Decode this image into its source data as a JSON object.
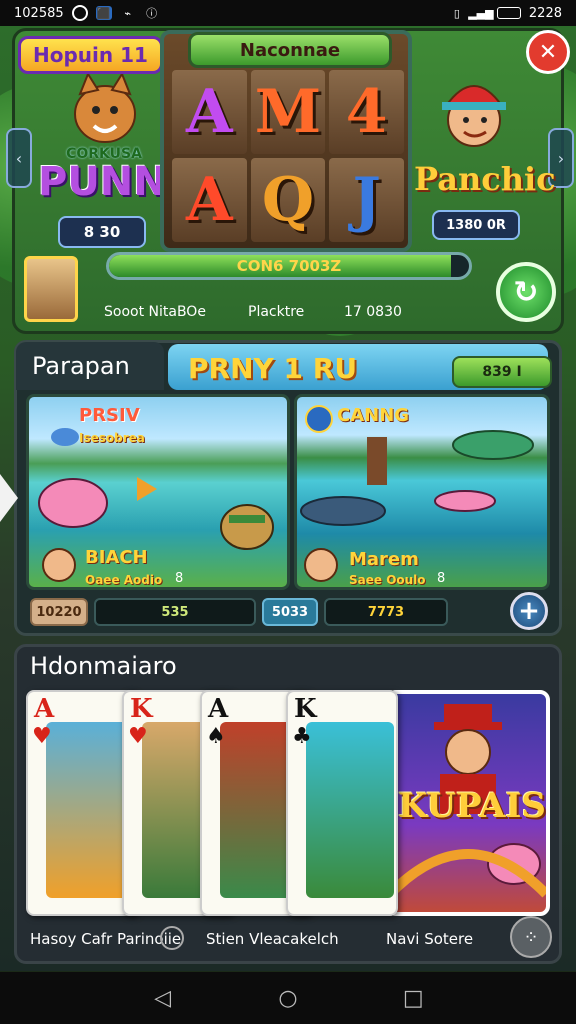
{
  "status_bar": {
    "time": "102585",
    "right_time": "2228"
  },
  "top_panel": {
    "badge": "Hopuin 11",
    "reel_header": "Naconnae",
    "reels": [
      "A",
      "M",
      "4",
      "A",
      "Q",
      "J"
    ],
    "reel_colors": [
      "#c24cf0",
      "#ff6a2a",
      "#ff6a2a",
      "#ff4a2a",
      "#f0a02a",
      "#3a7ae0"
    ],
    "left_logo_small": "CORKUSA",
    "left_logo_big": "PUNNA",
    "left_value": "8 30",
    "right_logo": "Panchic",
    "right_value": "1380 0R",
    "progress_text": "CON6 7003Z",
    "progress_fraction": 0.95,
    "info": [
      "Sooot NitaBOe",
      "Placktre",
      "17 0830"
    ]
  },
  "middle_panel": {
    "tab_title": "Parapan",
    "banner_text": "PRNY 1 RU",
    "badge_text": "839 I",
    "card_left": {
      "title": "PRSIV",
      "subtitle": "Isesobrea",
      "name": "BIACH",
      "line": "Oaee Aodio",
      "num": "8"
    },
    "card_right": {
      "title": "CANNG",
      "name": "Marem",
      "line": "Saee Ooulo",
      "num": "8"
    },
    "stats": [
      "10220",
      "535",
      "5033",
      "7773"
    ]
  },
  "bottom_panel": {
    "title": "Hdonmaiaro",
    "cards": [
      {
        "rank": "A",
        "suit": "♥",
        "color": "red"
      },
      {
        "rank": "K",
        "suit": "♥",
        "color": "red"
      },
      {
        "rank": "A",
        "suit": "♠",
        "color": "black"
      },
      {
        "rank": "K",
        "suit": "♣",
        "color": "black"
      }
    ],
    "feature_title": "KUPAIS",
    "labels": [
      "Hasoy Cafr Parinoiie",
      "Stien Vleacakelch",
      "Navi Sotere"
    ]
  }
}
